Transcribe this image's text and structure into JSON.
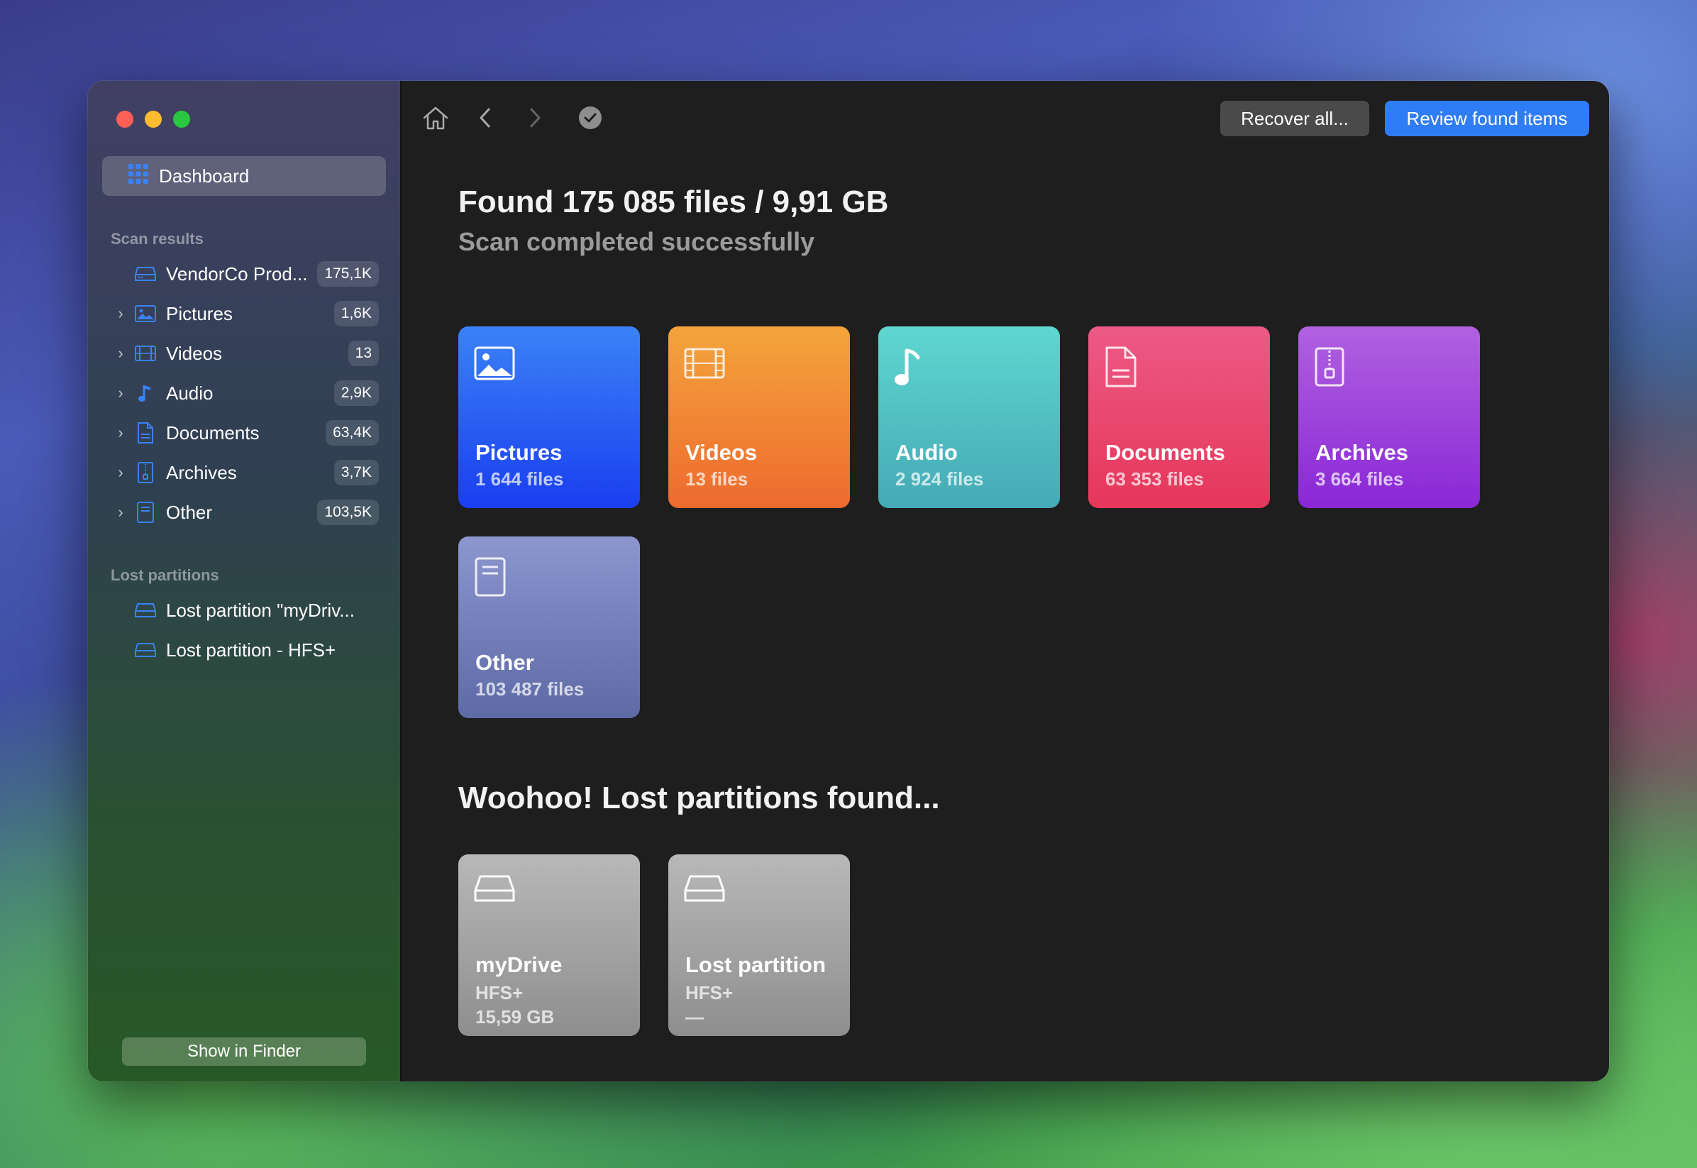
{
  "sidebar": {
    "dashboard_label": "Dashboard",
    "scan_results_title": "Scan results",
    "scan_items": [
      {
        "label": "VendorCo Prod...",
        "count": "175,1K",
        "icon": "drive-icon"
      },
      {
        "label": "Pictures",
        "count": "1,6K",
        "icon": "picture-icon"
      },
      {
        "label": "Videos",
        "count": "13",
        "icon": "film-icon"
      },
      {
        "label": "Audio",
        "count": "2,9K",
        "icon": "music-note-icon"
      },
      {
        "label": "Documents",
        "count": "63,4K",
        "icon": "document-icon"
      },
      {
        "label": "Archives",
        "count": "3,7K",
        "icon": "archive-icon"
      },
      {
        "label": "Other",
        "count": "103,5K",
        "icon": "other-file-icon"
      }
    ],
    "lost_partitions_title": "Lost partitions",
    "lost_items": [
      {
        "label": "Lost partition \"myDriv..."
      },
      {
        "label": "Lost partition - HFS+"
      }
    ],
    "show_in_finder": "Show in Finder"
  },
  "toolbar": {
    "recover_all": "Recover all...",
    "review_found": "Review found items"
  },
  "main": {
    "title": "Found 175 085 files / 9,91 GB",
    "subtitle": "Scan completed successfully",
    "categories": [
      {
        "name": "Pictures",
        "count": "1 644 files",
        "color_top": "#3b82f6",
        "color_bottom": "#1a3ef0"
      },
      {
        "name": "Videos",
        "count": "13 files",
        "color_top": "#f3a43c",
        "color_bottom": "#ee6a2e"
      },
      {
        "name": "Audio",
        "count": "2 924 files",
        "color_top": "#5fd6d0",
        "color_bottom": "#45aab6"
      },
      {
        "name": "Documents",
        "count": "63 353 files",
        "color_top": "#ec5a85",
        "color_bottom": "#e6365a"
      },
      {
        "name": "Archives",
        "count": "3 664 files",
        "color_top": "#b061e0",
        "color_bottom": "#8a27d6"
      },
      {
        "name": "Other",
        "count": "103 487 files",
        "color_top": "#8c96cf",
        "color_bottom": "#5e6aa6"
      }
    ],
    "partitions_heading": "Woohoo! Lost partitions found...",
    "partitions": [
      {
        "name": "myDrive",
        "fs": "HFS+",
        "size": "15,59 GB"
      },
      {
        "name": "Lost partition",
        "fs": "HFS+",
        "size": "—"
      }
    ]
  }
}
